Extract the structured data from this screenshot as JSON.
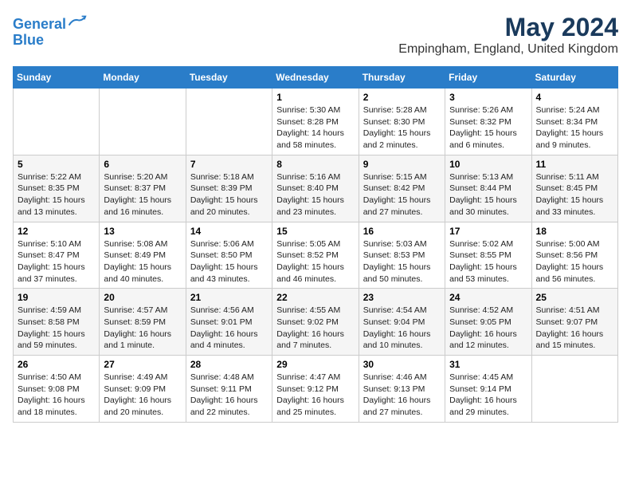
{
  "header": {
    "logo_line1": "General",
    "logo_line2": "Blue",
    "title": "May 2024",
    "subtitle": "Empingham, England, United Kingdom"
  },
  "days_of_week": [
    "Sunday",
    "Monday",
    "Tuesday",
    "Wednesday",
    "Thursday",
    "Friday",
    "Saturday"
  ],
  "weeks": [
    [
      {
        "day": "",
        "info": ""
      },
      {
        "day": "",
        "info": ""
      },
      {
        "day": "",
        "info": ""
      },
      {
        "day": "1",
        "info": "Sunrise: 5:30 AM\nSunset: 8:28 PM\nDaylight: 14 hours\nand 58 minutes."
      },
      {
        "day": "2",
        "info": "Sunrise: 5:28 AM\nSunset: 8:30 PM\nDaylight: 15 hours\nand 2 minutes."
      },
      {
        "day": "3",
        "info": "Sunrise: 5:26 AM\nSunset: 8:32 PM\nDaylight: 15 hours\nand 6 minutes."
      },
      {
        "day": "4",
        "info": "Sunrise: 5:24 AM\nSunset: 8:34 PM\nDaylight: 15 hours\nand 9 minutes."
      }
    ],
    [
      {
        "day": "5",
        "info": "Sunrise: 5:22 AM\nSunset: 8:35 PM\nDaylight: 15 hours\nand 13 minutes."
      },
      {
        "day": "6",
        "info": "Sunrise: 5:20 AM\nSunset: 8:37 PM\nDaylight: 15 hours\nand 16 minutes."
      },
      {
        "day": "7",
        "info": "Sunrise: 5:18 AM\nSunset: 8:39 PM\nDaylight: 15 hours\nand 20 minutes."
      },
      {
        "day": "8",
        "info": "Sunrise: 5:16 AM\nSunset: 8:40 PM\nDaylight: 15 hours\nand 23 minutes."
      },
      {
        "day": "9",
        "info": "Sunrise: 5:15 AM\nSunset: 8:42 PM\nDaylight: 15 hours\nand 27 minutes."
      },
      {
        "day": "10",
        "info": "Sunrise: 5:13 AM\nSunset: 8:44 PM\nDaylight: 15 hours\nand 30 minutes."
      },
      {
        "day": "11",
        "info": "Sunrise: 5:11 AM\nSunset: 8:45 PM\nDaylight: 15 hours\nand 33 minutes."
      }
    ],
    [
      {
        "day": "12",
        "info": "Sunrise: 5:10 AM\nSunset: 8:47 PM\nDaylight: 15 hours\nand 37 minutes."
      },
      {
        "day": "13",
        "info": "Sunrise: 5:08 AM\nSunset: 8:49 PM\nDaylight: 15 hours\nand 40 minutes."
      },
      {
        "day": "14",
        "info": "Sunrise: 5:06 AM\nSunset: 8:50 PM\nDaylight: 15 hours\nand 43 minutes."
      },
      {
        "day": "15",
        "info": "Sunrise: 5:05 AM\nSunset: 8:52 PM\nDaylight: 15 hours\nand 46 minutes."
      },
      {
        "day": "16",
        "info": "Sunrise: 5:03 AM\nSunset: 8:53 PM\nDaylight: 15 hours\nand 50 minutes."
      },
      {
        "day": "17",
        "info": "Sunrise: 5:02 AM\nSunset: 8:55 PM\nDaylight: 15 hours\nand 53 minutes."
      },
      {
        "day": "18",
        "info": "Sunrise: 5:00 AM\nSunset: 8:56 PM\nDaylight: 15 hours\nand 56 minutes."
      }
    ],
    [
      {
        "day": "19",
        "info": "Sunrise: 4:59 AM\nSunset: 8:58 PM\nDaylight: 15 hours\nand 59 minutes."
      },
      {
        "day": "20",
        "info": "Sunrise: 4:57 AM\nSunset: 8:59 PM\nDaylight: 16 hours\nand 1 minute."
      },
      {
        "day": "21",
        "info": "Sunrise: 4:56 AM\nSunset: 9:01 PM\nDaylight: 16 hours\nand 4 minutes."
      },
      {
        "day": "22",
        "info": "Sunrise: 4:55 AM\nSunset: 9:02 PM\nDaylight: 16 hours\nand 7 minutes."
      },
      {
        "day": "23",
        "info": "Sunrise: 4:54 AM\nSunset: 9:04 PM\nDaylight: 16 hours\nand 10 minutes."
      },
      {
        "day": "24",
        "info": "Sunrise: 4:52 AM\nSunset: 9:05 PM\nDaylight: 16 hours\nand 12 minutes."
      },
      {
        "day": "25",
        "info": "Sunrise: 4:51 AM\nSunset: 9:07 PM\nDaylight: 16 hours\nand 15 minutes."
      }
    ],
    [
      {
        "day": "26",
        "info": "Sunrise: 4:50 AM\nSunset: 9:08 PM\nDaylight: 16 hours\nand 18 minutes."
      },
      {
        "day": "27",
        "info": "Sunrise: 4:49 AM\nSunset: 9:09 PM\nDaylight: 16 hours\nand 20 minutes."
      },
      {
        "day": "28",
        "info": "Sunrise: 4:48 AM\nSunset: 9:11 PM\nDaylight: 16 hours\nand 22 minutes."
      },
      {
        "day": "29",
        "info": "Sunrise: 4:47 AM\nSunset: 9:12 PM\nDaylight: 16 hours\nand 25 minutes."
      },
      {
        "day": "30",
        "info": "Sunrise: 4:46 AM\nSunset: 9:13 PM\nDaylight: 16 hours\nand 27 minutes."
      },
      {
        "day": "31",
        "info": "Sunrise: 4:45 AM\nSunset: 9:14 PM\nDaylight: 16 hours\nand 29 minutes."
      },
      {
        "day": "",
        "info": ""
      }
    ]
  ]
}
